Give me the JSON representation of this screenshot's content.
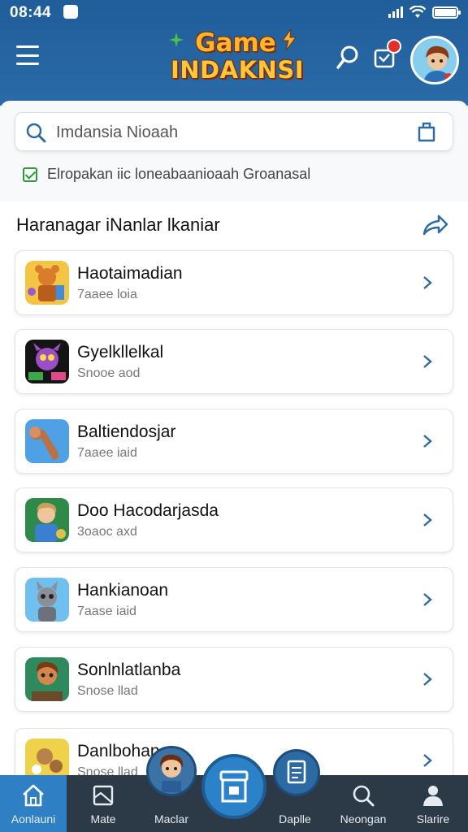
{
  "status_bar": {
    "time": "08:44"
  },
  "header": {
    "logo_line1": "Game",
    "logo_line2": "INDAKNSI",
    "menu_icon": "hamburger-icon",
    "search_icon": "search-icon",
    "chat_icon": "chat-icon",
    "avatar_icon": "avatar"
  },
  "search": {
    "placeholder": "Imdansia Nioaah"
  },
  "filter": {
    "checkbox_label": "Elropakan iic loneabaanioaah Groanasal",
    "checked": true
  },
  "section": {
    "title": "Haranagar iNanlar lkaniar"
  },
  "games": [
    {
      "title": "Haotaimadian",
      "subtitle": "7aaee loia",
      "icon": "game-icon-adventure"
    },
    {
      "title": "Gyelkllelkal",
      "subtitle": "Snooe aod",
      "icon": "game-icon-monster"
    },
    {
      "title": "Baltiendosjar",
      "subtitle": "7aaee iaid",
      "icon": "game-icon-fighter"
    },
    {
      "title": "Doo Hacodarjasda",
      "subtitle": "3oaoc axd",
      "icon": "game-icon-hero"
    },
    {
      "title": "Hankianoan",
      "subtitle": "7aase iaid",
      "icon": "game-icon-cat"
    },
    {
      "title": "Sonlnlatlanba",
      "subtitle": "Snose llad",
      "icon": "game-icon-warrior"
    },
    {
      "title": "Danlbohan",
      "subtitle": "Snose llad",
      "icon": "game-icon-puzzle"
    }
  ],
  "bottom_nav": [
    {
      "label": "Aonlauni",
      "icon": "home-icon",
      "active": true
    },
    {
      "label": "Mate",
      "icon": "box-icon",
      "active": false
    },
    {
      "label": "Maclar",
      "icon": "avatar-icon",
      "active": false
    },
    {
      "label": "Daplle",
      "icon": "document-icon",
      "active": false
    },
    {
      "label": "Neongan",
      "icon": "search-icon",
      "active": false
    },
    {
      "label": "Slarire",
      "icon": "user-icon",
      "active": false
    }
  ],
  "colors": {
    "header_bg": "#2a6aa6",
    "nav_bg": "#2c3a47",
    "active_nav": "#2e7fc4",
    "accent": "#2c82c9"
  }
}
